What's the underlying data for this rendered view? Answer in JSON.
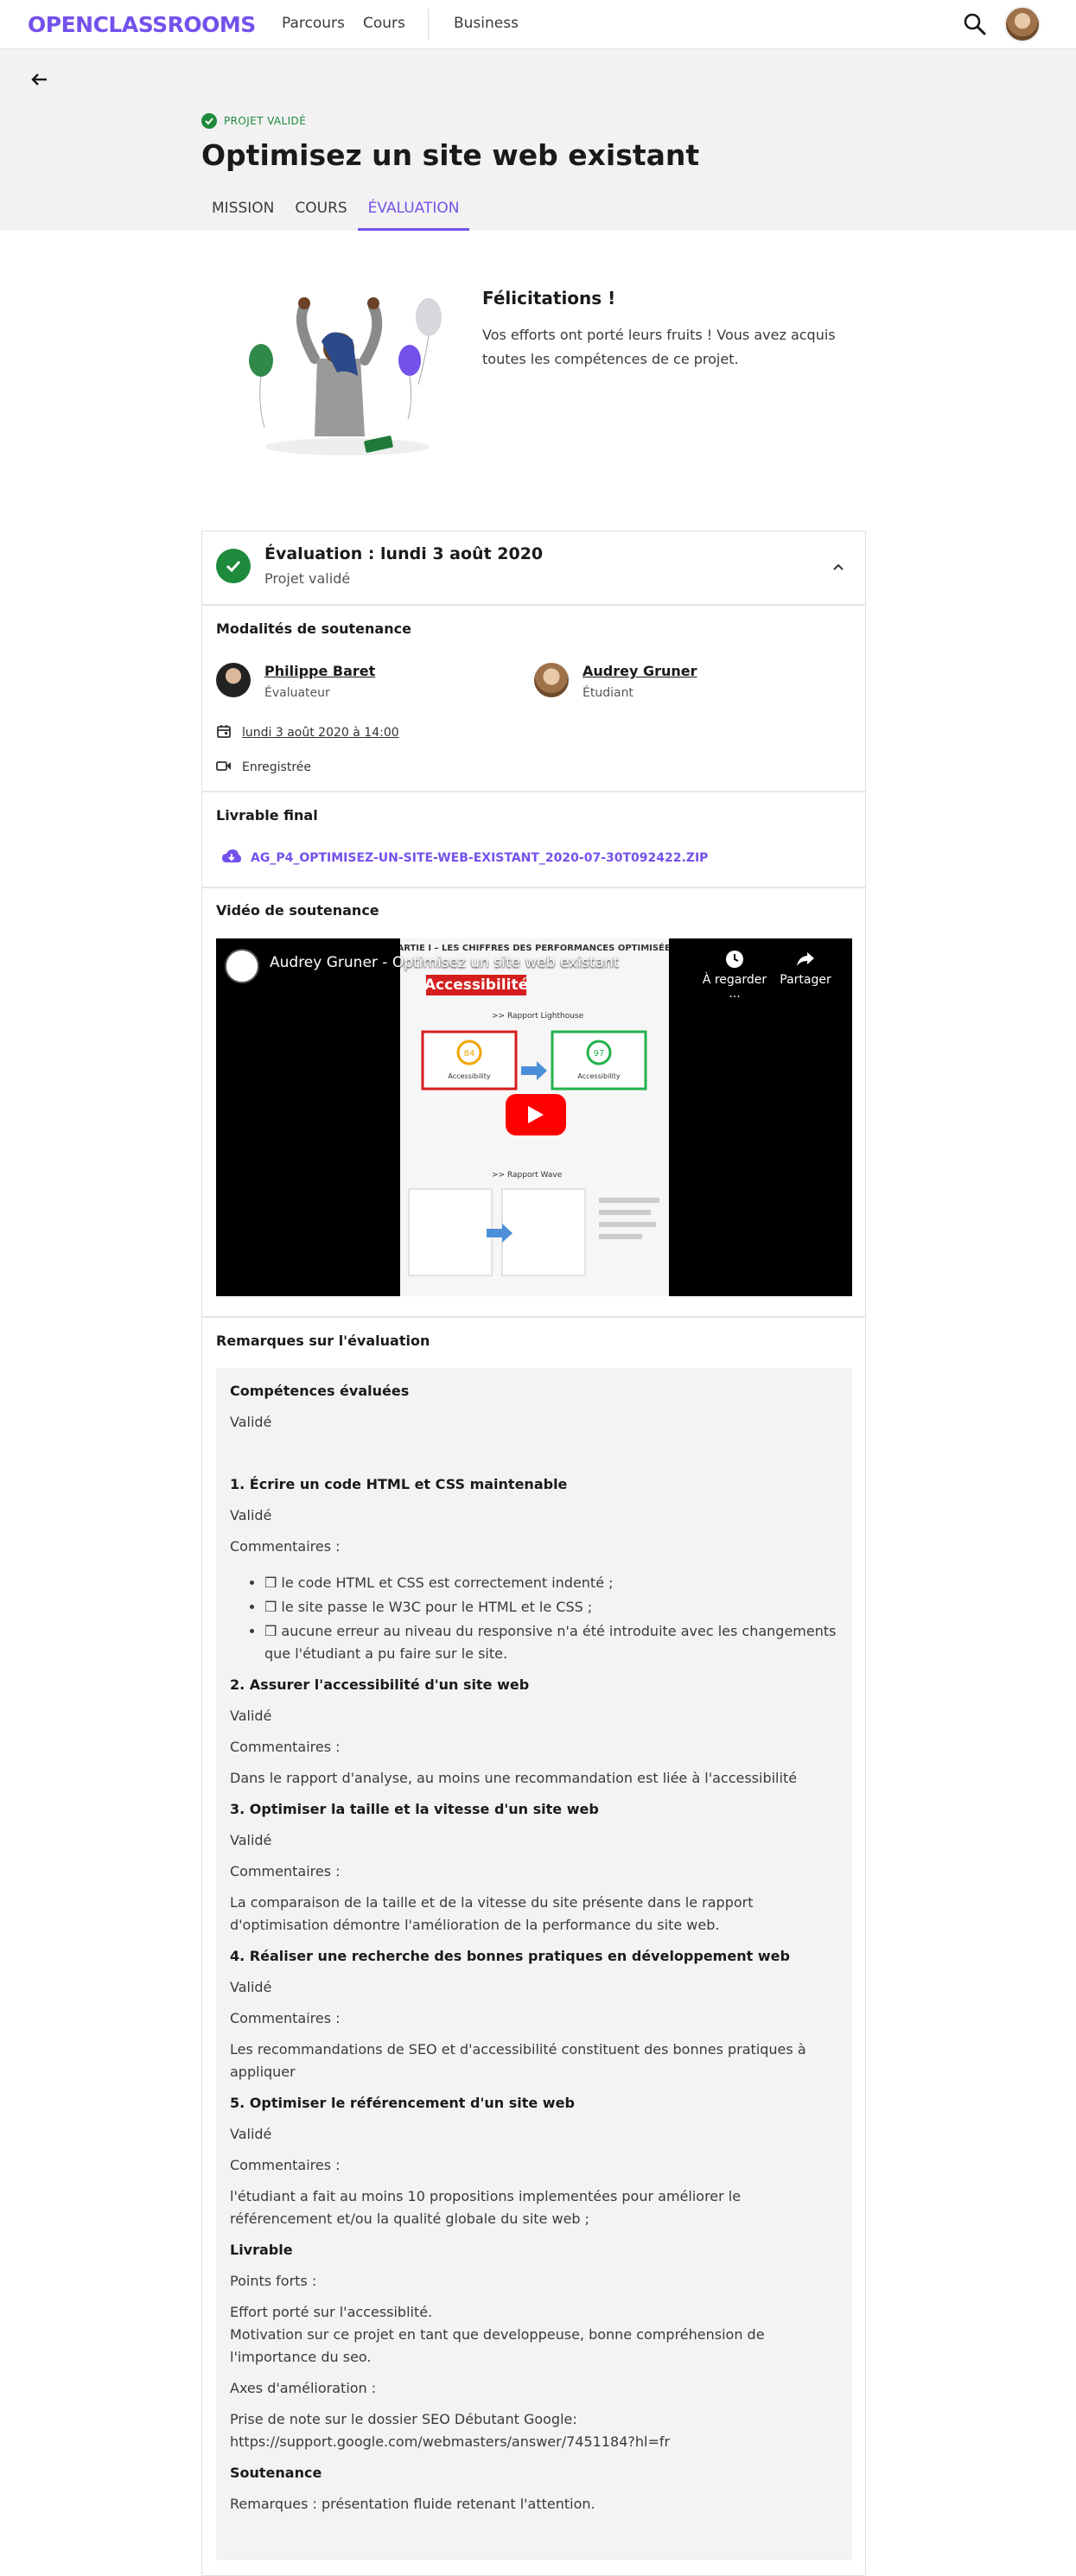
{
  "nav": {
    "logo": "OPENCLASSROOMS",
    "links": [
      "Parcours",
      "Cours",
      "Business"
    ]
  },
  "header": {
    "badge": "PROJET VALIDÉ",
    "title": "Optimisez un site web existant",
    "tabs": [
      "MISSION",
      "COURS",
      "ÉVALUATION"
    ],
    "active_tab": "ÉVALUATION"
  },
  "congrats": {
    "title": "Félicitations !",
    "text": "Vos efforts ont porté leurs fruits ! Vous avez acquis toutes les compétences de ce projet."
  },
  "evaluation": {
    "title": "Évaluation : lundi 3 août 2020",
    "status": "Projet validé",
    "modalites_title": "Modalités de soutenance",
    "evaluator": {
      "name": "Philippe Baret",
      "role": "Évaluateur"
    },
    "student": {
      "name": "Audrey Gruner",
      "role": "Étudiant"
    },
    "date": "lundi 3 août 2020 à 14:00",
    "recorded": "Enregistrée",
    "livrable_title": "Livrable final",
    "livrable_file": "AG_P4_OPTIMISEZ-UN-SITE-WEB-EXISTANT_2020-07-30T092422.ZIP",
    "video_title": "Vidéo de soutenance",
    "video": {
      "caption": "Audrey Gruner - Optimisez un site web existant",
      "watch_later": "À regarder ...",
      "share": "Partager",
      "slide_heading": "PARTIE I – LES CHIFFRES DES PERFORMANCES OPTIMISÉES",
      "slide_tag": "Accessibilité",
      "slide_sub1": ">> Rapport Lighthouse",
      "slide_sub2": ">> Rapport Wave",
      "score_before": "84",
      "score_after": "97",
      "score_label": "Accessibility"
    },
    "remarks_title": "Remarques sur l'évaluation"
  },
  "remarks": {
    "competences_title": "Compétences évaluées",
    "competences_status": "Validé",
    "c1_title": "1. Écrire un code HTML et CSS maintenable",
    "c1_status": "Validé",
    "c1_comments_label": "Commentaires :",
    "c1_bullets": [
      "❒ le code HTML et CSS est correctement indenté ;",
      "❒ le site passe le W3C pour le HTML et le CSS ;",
      "❒ aucune erreur au niveau du responsive n'a été introduite avec les changements que l'étudiant a pu faire sur le site."
    ],
    "c2_title": "2. Assurer l'accessibilité d'un site web",
    "c2_status": "Validé",
    "c2_comments_label": "Commentaires :",
    "c2_comment": "Dans le rapport d'analyse, au moins une recommandation est liée à l'accessibilité",
    "c3_title": "3. Optimiser la taille et la vitesse d'un site web",
    "c3_status": "Validé",
    "c3_comments_label": "Commentaires :",
    "c3_comment": "La comparaison de la taille et de la vitesse du site présente dans le rapport d'optimisation démontre l'amélioration de la performance du site web.",
    "c4_title": "4. Réaliser une recherche des bonnes pratiques en développement web",
    "c4_status": "Validé",
    "c4_comments_label": "Commentaires :",
    "c4_comment": "Les recommandations de SEO et d'accessibilité constituent des bonnes pratiques à appliquer",
    "c5_title": "5. Optimiser le référencement d'un site web",
    "c5_status": "Validé",
    "c5_comments_label": "Commentaires :",
    "c5_comment": "l'étudiant a fait au moins 10 propositions implementées pour améliorer le référencement et/ou la qualité globale du site web ;",
    "livrable_title": "Livrable",
    "points_forts_label": "Points forts :",
    "points_forts_1": "Effort porté sur l'accessiblité.",
    "points_forts_2": "Motivation sur ce projet en tant que developpeuse, bonne compréhension de l'importance du seo.",
    "axes_label": "Axes d'amélioration :",
    "axes_1": "Prise de note sur le dossier SEO Débutant Google:",
    "axes_2": "https://support.google.com/webmasters/answer/7451184?hl=fr",
    "soutenance_title": "Soutenance",
    "soutenance_text": "Remarques : présentation fluide retenant l'attention."
  },
  "colors": {
    "brand": "#7451eb",
    "success": "#1e8a3c",
    "youtube": "#ff0000"
  }
}
